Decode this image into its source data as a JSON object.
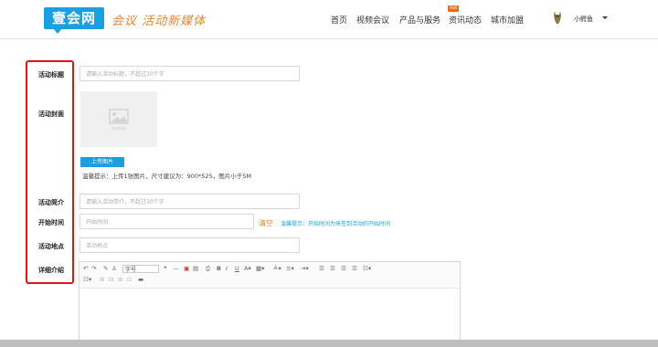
{
  "header": {
    "logo": "壹会网",
    "slogan": "会议 活动新媒体",
    "nav": [
      "首页",
      "视频会议",
      "产品与服务",
      "资讯动态",
      "城市加盟"
    ],
    "hot_badge": "hot",
    "user": "小鳄鱼"
  },
  "form": {
    "title_label": "活动标题",
    "title_placeholder": "请输入活动标题，不超过30个字",
    "cover_label": "活动封面",
    "upload_button": "上传图片",
    "upload_tip": "温馨提示：上传1张图片，尺寸建议为：900*525，图片小于5M",
    "intro_label": "活动简介",
    "intro_placeholder": "请输入活动简介，不超过30个字",
    "start_label": "开始时间",
    "start_placeholder": "开始时间",
    "clear_link": "清空",
    "start_tip": "温馨提示：开始时间为来签到活动的开始时间",
    "location_label": "活动地点",
    "location_placeholder": "活动地点",
    "detail_label": "详细介绍"
  },
  "editor": {
    "font_size_select": "字号",
    "bold": "B",
    "italic": "I",
    "underline": "U"
  },
  "colors": {
    "brand": "#1a9fe0",
    "accent_orange": "#e8862c",
    "highlight_red": "#e01515"
  }
}
